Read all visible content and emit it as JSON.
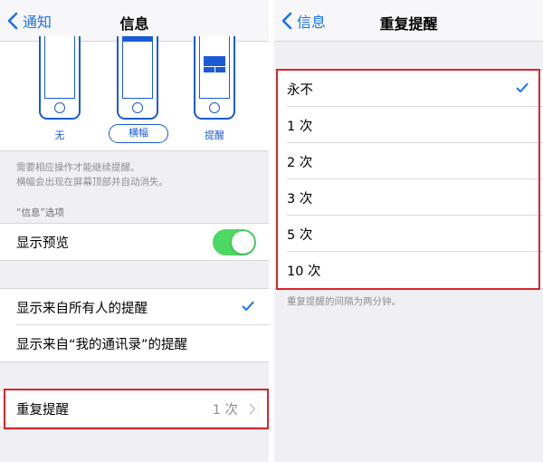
{
  "left": {
    "nav": {
      "back_label": "通知",
      "title": "信息"
    },
    "styles": {
      "none_label": "无",
      "banner_label": "横幅",
      "alert_label": "提醒"
    },
    "note_line1": "需要相应操作才能继续提醒。",
    "note_line2": "横幅会出现在屏幕顶部并自动消失。",
    "section_header": "“信息”选项",
    "show_preview_label": "显示预览",
    "show_preview_on": true,
    "from_everyone_label": "显示来自所有人的提醒",
    "from_contacts_label": "显示来自“我的通讯录”的提醒",
    "repeat_label": "重复提醒",
    "repeat_value": "1 次"
  },
  "right": {
    "nav": {
      "back_label": "信息",
      "title": "重复提醒"
    },
    "options": [
      "永不",
      "1 次",
      "2 次",
      "3 次",
      "5 次",
      "10 次"
    ],
    "selected_index": 0,
    "footer": "重复提醒的间隔为两分钟。"
  },
  "colors": {
    "accent": "#1a73e8",
    "toggle_on": "#4cd964",
    "highlight_box": "#d8262c"
  },
  "icons": [
    "chevron-left-icon",
    "checkmark-icon",
    "chevron-right-icon"
  ]
}
